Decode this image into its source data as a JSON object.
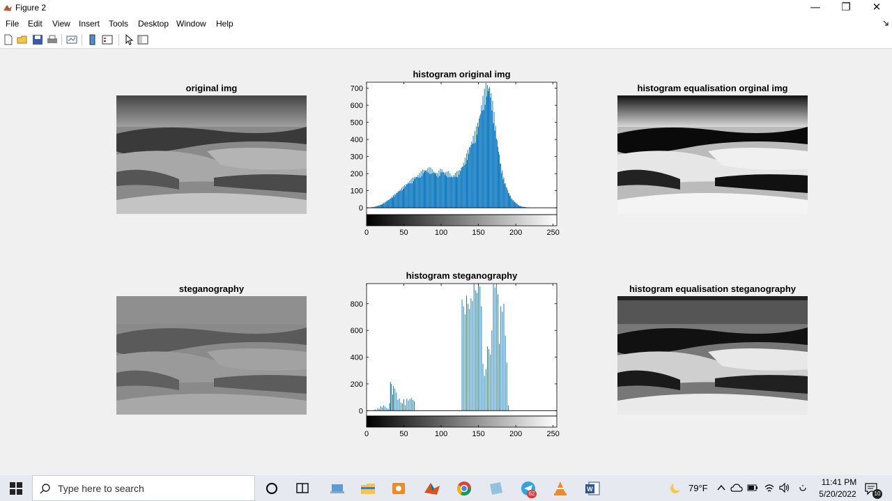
{
  "window": {
    "title": "Figure 2",
    "minimize": "—",
    "restore": "❐",
    "close": "✕"
  },
  "menu": [
    "File",
    "Edit",
    "View",
    "Insert",
    "Tools",
    "Desktop",
    "Window",
    "Help"
  ],
  "toolbar": [
    "new-figure-icon",
    "open-icon",
    "save-icon",
    "print-icon",
    "link-plot-icon",
    "insert-colorbar-icon",
    "insert-legend-icon",
    "select-arrow-icon",
    "property-inspector-icon"
  ],
  "plots": {
    "original": {
      "title": "original img"
    },
    "hist_original": {
      "title": "histogram original img"
    },
    "eq_original": {
      "title": "histogram equalisation orginal img"
    },
    "stego": {
      "title": "steganography"
    },
    "hist_stego": {
      "title": "histogram steganography"
    },
    "eq_stego": {
      "title": "histogram equalisation steganography"
    }
  },
  "chart_data": [
    {
      "type": "bar",
      "title": "histogram original img",
      "xlim": [
        0,
        255
      ],
      "ylim": [
        -40,
        735
      ],
      "xticks": [
        0,
        50,
        100,
        150,
        200,
        250
      ],
      "yticks": [
        0,
        100,
        200,
        300,
        400,
        500,
        600,
        700
      ],
      "color": "#0072bd",
      "envelope_x": [
        0,
        5,
        10,
        20,
        30,
        40,
        50,
        60,
        70,
        75,
        80,
        85,
        90,
        95,
        100,
        105,
        110,
        115,
        120,
        125,
        130,
        135,
        140,
        145,
        150,
        155,
        160,
        165,
        170,
        175,
        180,
        185,
        190,
        195,
        200,
        205,
        210,
        215,
        220,
        230,
        240,
        250,
        255
      ],
      "envelope_y": [
        0,
        2,
        5,
        20,
        50,
        90,
        130,
        170,
        200,
        225,
        230,
        240,
        220,
        205,
        235,
        210,
        215,
        190,
        210,
        225,
        270,
        330,
        390,
        450,
        520,
        640,
        735,
        735,
        600,
        410,
        260,
        160,
        95,
        55,
        30,
        12,
        6,
        3,
        1,
        0,
        0,
        0,
        0
      ]
    },
    {
      "type": "bar",
      "title": "histogram steganography",
      "xlim": [
        0,
        255
      ],
      "ylim": [
        -40,
        950
      ],
      "xticks": [
        0,
        50,
        100,
        150,
        200,
        250
      ],
      "yticks": [
        0,
        200,
        400,
        600,
        800
      ],
      "color": "#0072bd",
      "bars_x": [
        10,
        12,
        15,
        17,
        19,
        21,
        23,
        25,
        27,
        29,
        31,
        32,
        33,
        35,
        36,
        38,
        40,
        42,
        44,
        46,
        48,
        50,
        52,
        54,
        56,
        58,
        60,
        62,
        64,
        128,
        130,
        132,
        134,
        136,
        138,
        140,
        142,
        144,
        146,
        148,
        150,
        152,
        154,
        156,
        158,
        160,
        162,
        164,
        166,
        168,
        170,
        172,
        174,
        176,
        178,
        180,
        182,
        184,
        186,
        188,
        190
      ],
      "bars_y": [
        5,
        10,
        20,
        15,
        35,
        25,
        40,
        30,
        20,
        15,
        55,
        215,
        200,
        120,
        185,
        165,
        135,
        80,
        90,
        60,
        55,
        85,
        40,
        90,
        75,
        85,
        95,
        80,
        70,
        830,
        780,
        720,
        860,
        800,
        760,
        840,
        820,
        950,
        900,
        880,
        950,
        930,
        780,
        350,
        260,
        310,
        480,
        460,
        420,
        600,
        950,
        920,
        950,
        870,
        500,
        780,
        740,
        800,
        560,
        360,
        40
      ]
    }
  ],
  "taskbar": {
    "search_placeholder": "Type here to search",
    "weather": "79°F",
    "time": "11:41 PM",
    "date": "5/20/2022",
    "notifications": "10",
    "telegram_badge": "62"
  }
}
